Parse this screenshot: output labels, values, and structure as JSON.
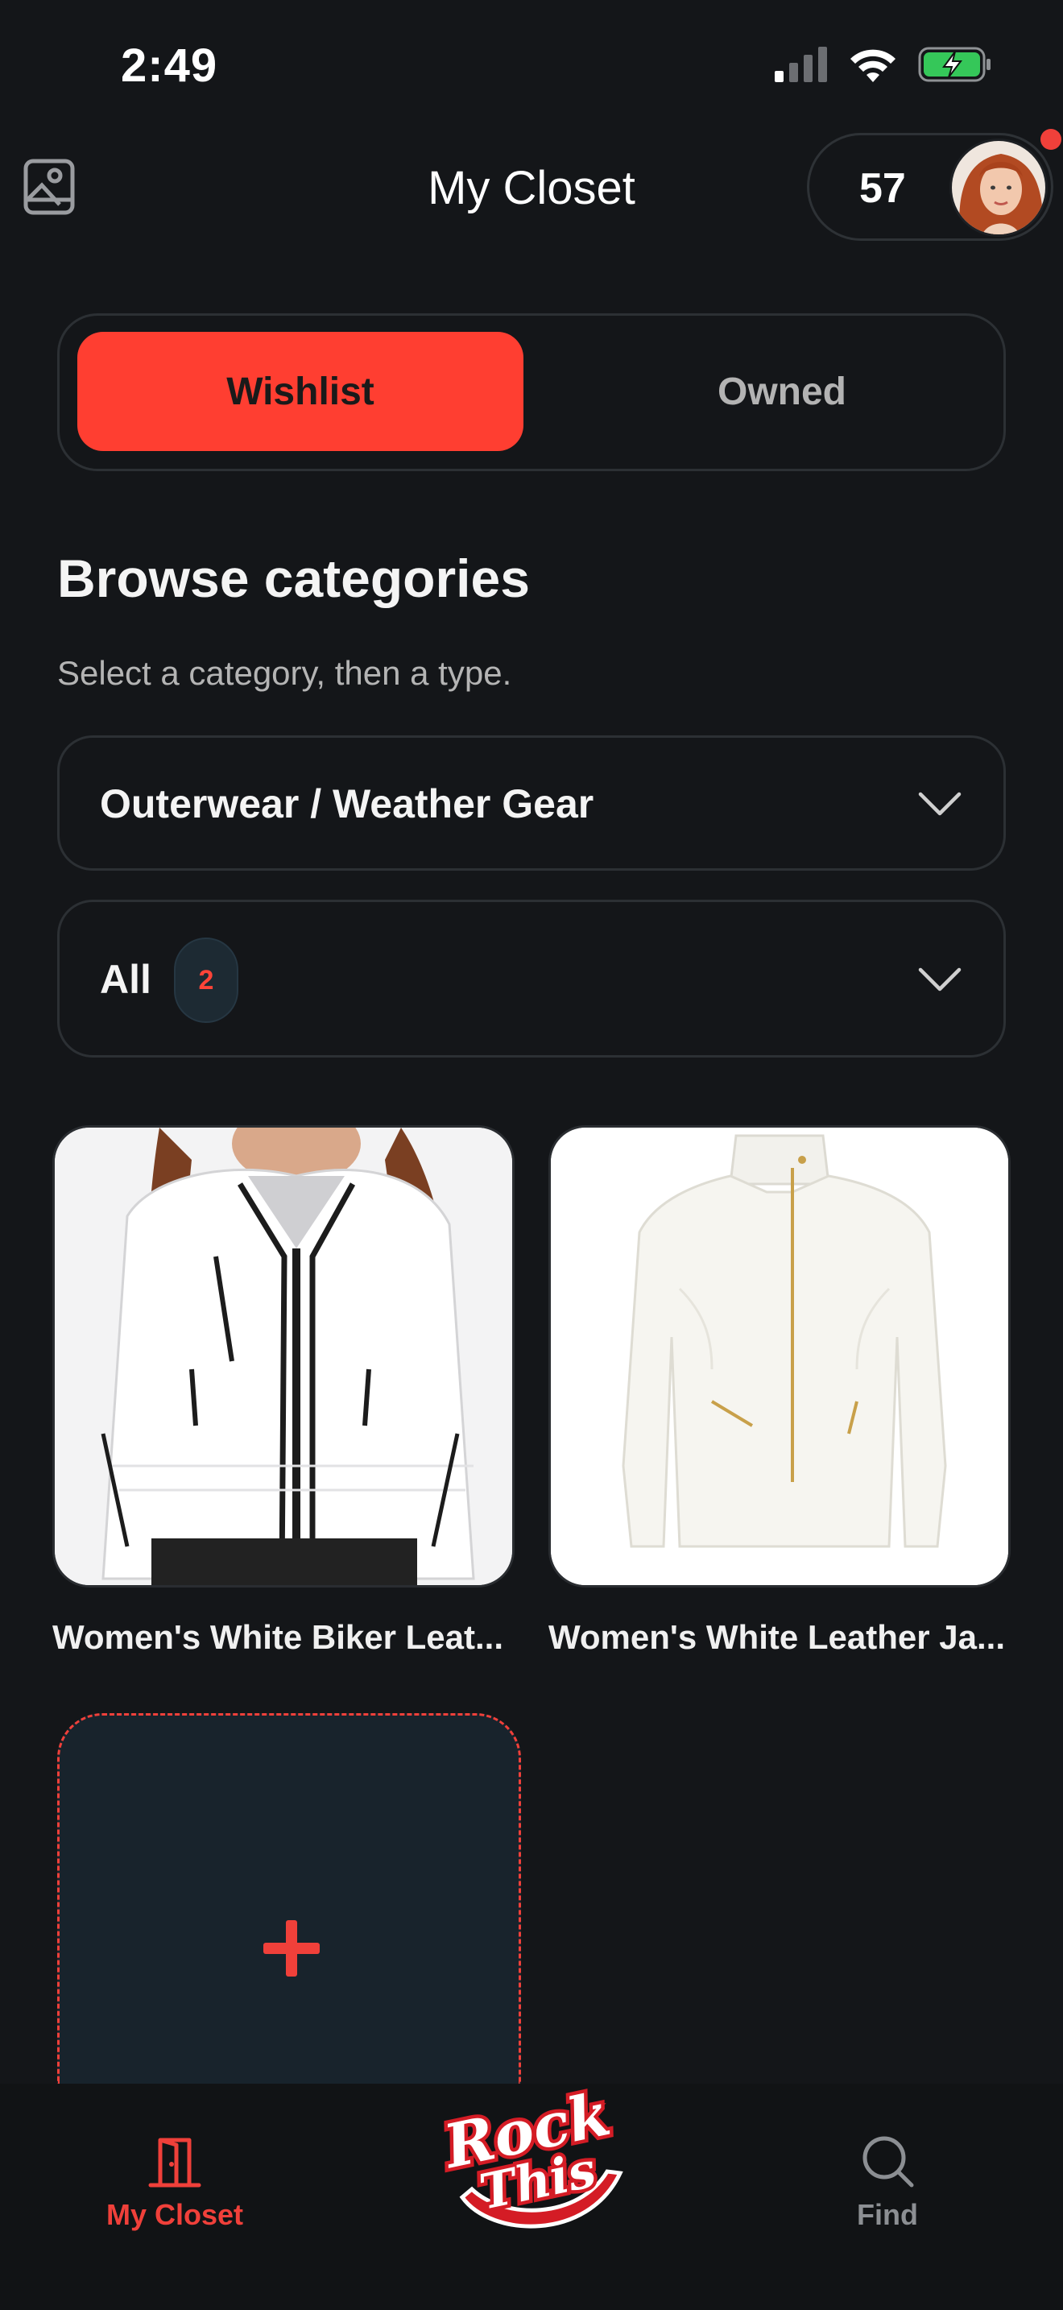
{
  "status_bar": {
    "time": "2:49"
  },
  "header": {
    "title": "My Closet",
    "counter_value": "57",
    "has_notification": true
  },
  "segment": {
    "options": [
      "Wishlist",
      "Owned"
    ],
    "selected": "Wishlist"
  },
  "browse": {
    "title": "Browse categories",
    "subtitle": "Select a category, then a type."
  },
  "category_select": {
    "value": "Outerwear / Weather Gear"
  },
  "type_select": {
    "value": "All",
    "count": "2"
  },
  "items": [
    {
      "title": "Women's White Biker Leat..."
    },
    {
      "title": "Women's White Leather Ja..."
    }
  ],
  "tabbar": {
    "items": [
      {
        "label": "My Closet",
        "icon": "door-icon",
        "active": true
      },
      {
        "label": "Find",
        "icon": "search-icon",
        "active": false
      }
    ],
    "brand": "Rock This"
  },
  "colors": {
    "accent": "#ff3e31",
    "background": "#141619",
    "border": "#2c3034"
  }
}
